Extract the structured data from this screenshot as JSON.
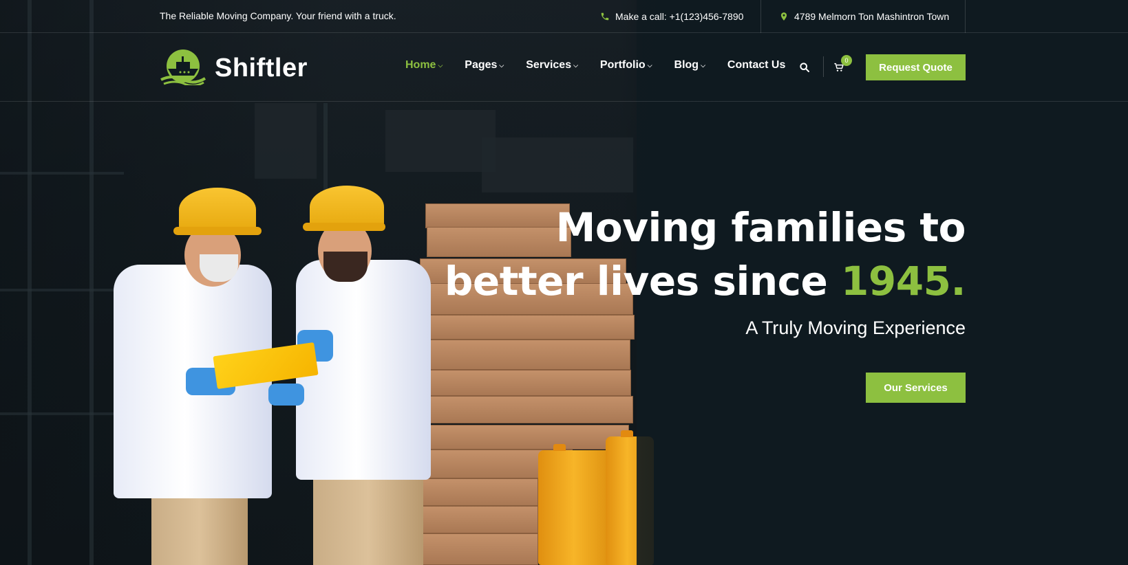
{
  "topbar": {
    "tagline": "The Reliable Moving Company. Your friend with a truck.",
    "phone": "Make a call: +1(123)456-7890",
    "address": "4789 Melmorn Ton Mashintron Town"
  },
  "brand": {
    "name": "Shiftler",
    "accent_color": "#8dc040"
  },
  "nav": {
    "items": [
      {
        "label": "Home",
        "active": true,
        "has_dropdown": true
      },
      {
        "label": "Pages",
        "active": false,
        "has_dropdown": true
      },
      {
        "label": "Services",
        "active": false,
        "has_dropdown": true
      },
      {
        "label": "Portfolio",
        "active": false,
        "has_dropdown": true
      },
      {
        "label": "Blog",
        "active": false,
        "has_dropdown": true
      },
      {
        "label": "Contact Us",
        "active": false,
        "has_dropdown": false
      }
    ],
    "search_icon": "search-icon",
    "cart_icon": "cart-icon",
    "cart_count": "0",
    "quote_label": "Request Quote"
  },
  "hero": {
    "title_line1": "Moving families to",
    "title_line2_prefix": "better lives since ",
    "title_line2_accent": "1945.",
    "subtitle": "A Truly Moving Experience",
    "cta_label": "Our Services"
  }
}
